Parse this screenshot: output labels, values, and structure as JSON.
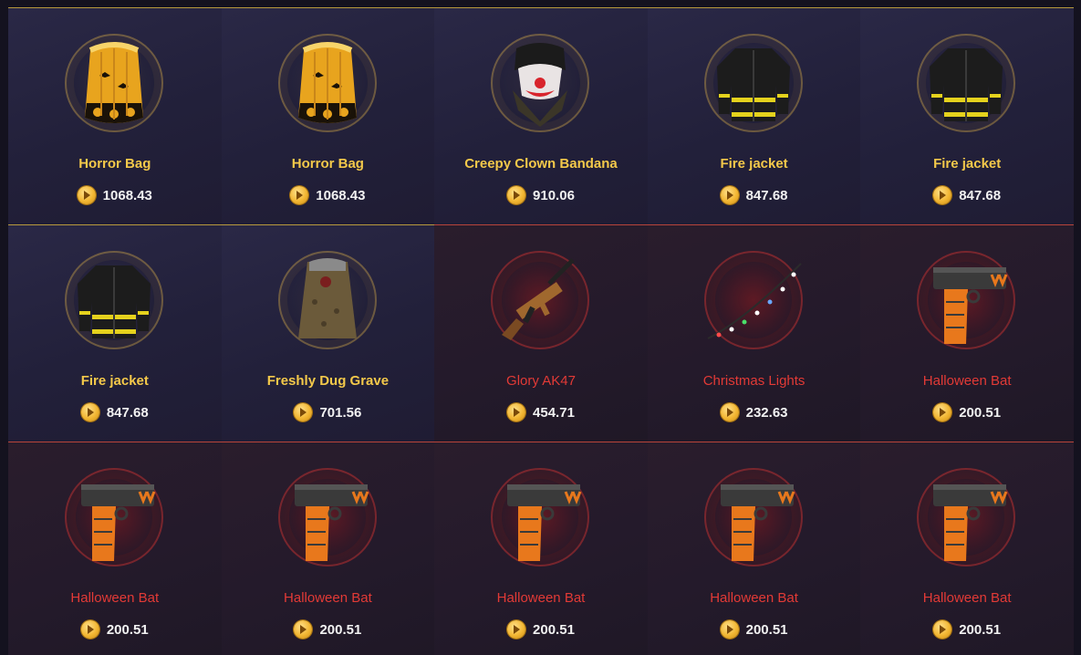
{
  "items": [
    {
      "name": "Horror Bag",
      "price": "1068.43",
      "rarity": "gold",
      "icon": "horror-bag-icon"
    },
    {
      "name": "Horror Bag",
      "price": "1068.43",
      "rarity": "gold",
      "icon": "horror-bag-icon"
    },
    {
      "name": "Creepy Clown Bandana",
      "price": "910.06",
      "rarity": "gold",
      "icon": "clown-bandana-icon"
    },
    {
      "name": "Fire jacket",
      "price": "847.68",
      "rarity": "gold",
      "icon": "fire-jacket-icon"
    },
    {
      "name": "Fire jacket",
      "price": "847.68",
      "rarity": "gold",
      "icon": "fire-jacket-icon"
    },
    {
      "name": "Fire jacket",
      "price": "847.68",
      "rarity": "gold",
      "icon": "fire-jacket-icon"
    },
    {
      "name": "Freshly Dug Grave",
      "price": "701.56",
      "rarity": "gold",
      "icon": "dug-grave-icon"
    },
    {
      "name": "Glory AK47",
      "price": "454.71",
      "rarity": "red",
      "icon": "ak47-icon"
    },
    {
      "name": "Christmas Lights",
      "price": "232.63",
      "rarity": "red",
      "icon": "christmas-lights-icon"
    },
    {
      "name": "Halloween Bat",
      "price": "200.51",
      "rarity": "red",
      "icon": "halloween-pistol-icon"
    },
    {
      "name": "Halloween Bat",
      "price": "200.51",
      "rarity": "red",
      "icon": "halloween-pistol-icon"
    },
    {
      "name": "Halloween Bat",
      "price": "200.51",
      "rarity": "red",
      "icon": "halloween-pistol-icon"
    },
    {
      "name": "Halloween Bat",
      "price": "200.51",
      "rarity": "red",
      "icon": "halloween-pistol-icon"
    },
    {
      "name": "Halloween Bat",
      "price": "200.51",
      "rarity": "red",
      "icon": "halloween-pistol-icon"
    },
    {
      "name": "Halloween Bat",
      "price": "200.51",
      "rarity": "red",
      "icon": "halloween-pistol-icon"
    }
  ],
  "colors": {
    "gold_text": "#f4c94a",
    "red_text": "#e23a36",
    "price_text": "#f2f2f2",
    "coin": "#f2b632"
  }
}
